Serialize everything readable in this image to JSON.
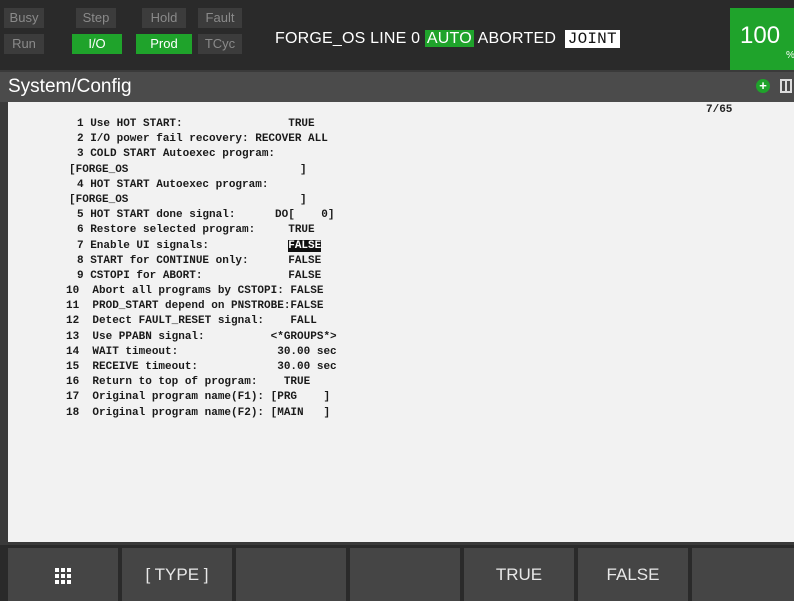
{
  "indicators": {
    "busy": "Busy",
    "step": "Step",
    "hold": "Hold",
    "fault": "Fault",
    "run": "Run",
    "io": "I/O",
    "prod": "Prod",
    "tcyc": "TCyc"
  },
  "status": {
    "program": "FORGE_OS LINE 0",
    "mode": "AUTO",
    "state": "ABORTED",
    "coord": "JOINT",
    "speed": "100",
    "speed_unit": "%"
  },
  "screen": {
    "title": "System/Config",
    "page_count": "7/65"
  },
  "config_lines": [
    "1 Use HOT START:                TRUE",
    "2 I/O power fail recovery: RECOVER ALL",
    "3 COLD START Autoexec program:",
    "[FORGE_OS                          ]",
    "4 HOT START Autoexec program:",
    "[FORGE_OS                          ]",
    "5 HOT START done signal:      DO[    0]",
    "6 Restore selected program:     TRUE",
    "7 Enable UI signals:            ",
    "8 START for CONTINUE only:      FALSE",
    "9 CSTOPI for ABORT:             FALSE",
    "10  Abort all programs by CSTOPI: FALSE",
    "11  PROD_START depend on PNSTROBE:FALSE",
    "12  Detect FAULT_RESET signal:    FALL",
    "13  Use PPABN signal:          <*GROUPS*>",
    "14  WAIT timeout:               30.00 sec",
    "15  RECEIVE timeout:            30.00 sec",
    "16  Return to top of program:    TRUE",
    "17  Original program name(F1): [PRG    ]",
    "18  Original program name(F2): [MAIN   ]"
  ],
  "selected_value": "FALSE",
  "function_keys": {
    "f1": "[ TYPE ]",
    "f4": "TRUE",
    "f5": "FALSE"
  },
  "colors": {
    "active_indicator": "#1fa32b",
    "selection": "#111111"
  }
}
